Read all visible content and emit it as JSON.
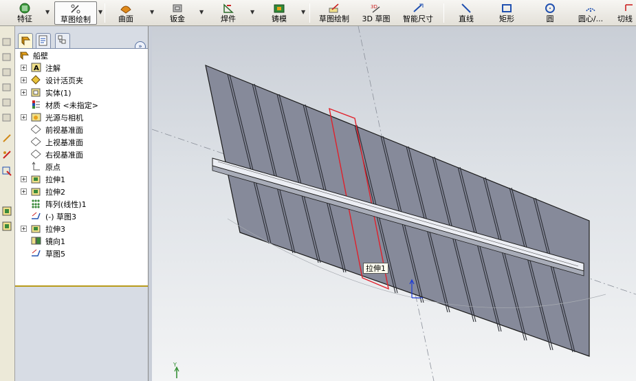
{
  "toolbar": {
    "items": [
      {
        "label": "特征",
        "icon": "feature-icon"
      },
      {
        "label": "草图绘制",
        "icon": "sketch-icon"
      },
      {
        "label": "曲面",
        "icon": "surface-icon"
      },
      {
        "label": "钣金",
        "icon": "sheetmetal-icon"
      },
      {
        "label": "焊件",
        "icon": "weldment-icon"
      },
      {
        "label": "铸模",
        "icon": "mold-icon"
      },
      {
        "label": "草图绘制",
        "icon": "sketch-icon"
      },
      {
        "label": "3D 草图",
        "icon": "3d-sketch-icon"
      },
      {
        "label": "智能尺寸",
        "icon": "smart-dimension-icon"
      },
      {
        "label": "直线",
        "icon": "line-icon"
      },
      {
        "label": "矩形",
        "icon": "rectangle-icon"
      },
      {
        "label": "圆",
        "icon": "circle-icon"
      },
      {
        "label": "圆心/...",
        "icon": "center-arc-icon"
      },
      {
        "label": "切线",
        "icon": "tangent-arc-icon"
      }
    ]
  },
  "feature_tree": {
    "root": "船壁",
    "items": [
      {
        "label": "注解",
        "icon": "annotation-icon",
        "expandable": true
      },
      {
        "label": "设计活页夹",
        "icon": "design-binder-icon",
        "expandable": true
      },
      {
        "label": "实体(1)",
        "icon": "solid-bodies-icon",
        "expandable": true
      },
      {
        "label": "材质 <未指定>",
        "icon": "material-icon",
        "expandable": false
      },
      {
        "label": "光源与相机",
        "icon": "lights-cameras-icon",
        "expandable": true
      },
      {
        "label": "前视基准面",
        "icon": "plane-icon",
        "expandable": false
      },
      {
        "label": "上视基准面",
        "icon": "plane-icon",
        "expandable": false
      },
      {
        "label": "右视基准面",
        "icon": "plane-icon",
        "expandable": false
      },
      {
        "label": "原点",
        "icon": "origin-icon",
        "expandable": false
      },
      {
        "label": "拉伸1",
        "icon": "extrude-icon",
        "expandable": true
      },
      {
        "label": "拉伸2",
        "icon": "extrude-icon",
        "expandable": true
      },
      {
        "label": "阵列(线性)1",
        "icon": "linear-pattern-icon",
        "expandable": false
      },
      {
        "label": "(-) 草图3",
        "icon": "sketch-icon",
        "expandable": false
      },
      {
        "label": "拉伸3",
        "icon": "extrude-icon",
        "expandable": true
      },
      {
        "label": "镜向1",
        "icon": "mirror-icon",
        "expandable": false
      },
      {
        "label": "草图5",
        "icon": "sketch-icon",
        "expandable": false
      }
    ]
  },
  "viewport": {
    "tooltip": "拉伸1",
    "triad_y_label": "Y",
    "colors": {
      "face": "#868a9a",
      "edge": "#1a1a1a",
      "highlight": "#e0202a",
      "triad": "#1a3ad8"
    }
  }
}
